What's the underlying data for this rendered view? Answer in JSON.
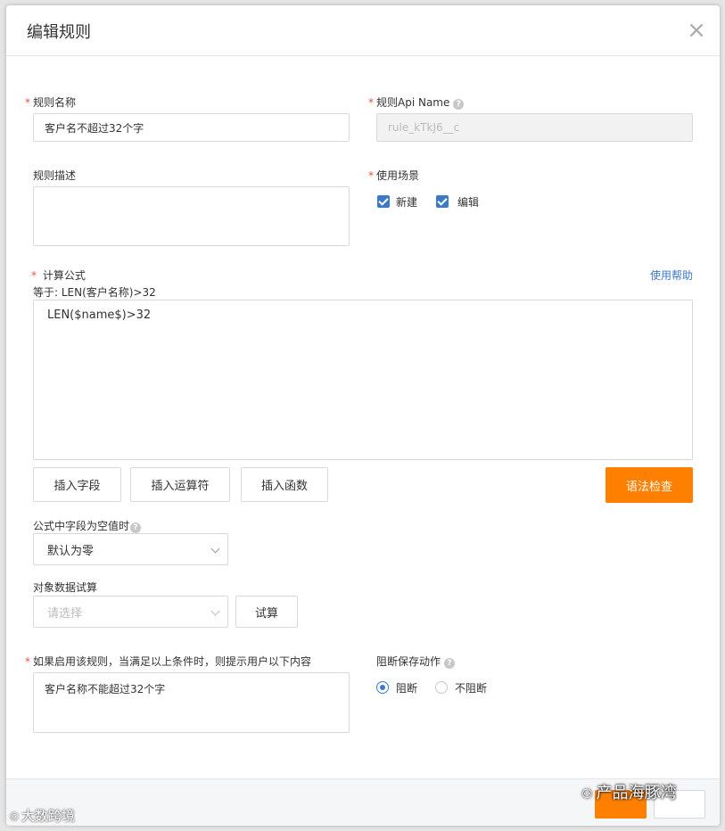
{
  "dialog": {
    "title": "编辑规则",
    "close_glyph": "×"
  },
  "required_mark": "*",
  "rule_name": {
    "label": "规则名称",
    "value": "客户名不超过32个字"
  },
  "rule_api_name": {
    "label": "规则Api Name",
    "help_glyph": "?",
    "value": "rule_kTkJ6__c"
  },
  "rule_description": {
    "label": "规则描述",
    "value": ""
  },
  "usage_scene": {
    "label": "使用场景",
    "options": [
      {
        "label": "新建",
        "checked": true
      },
      {
        "label": "编辑",
        "checked": true
      }
    ]
  },
  "formula": {
    "label": "计算公式",
    "help_link": "使用帮助",
    "equals_text": "等于: LEN(客户名称)>32",
    "value": "LEN($name$)>32",
    "insert_field": "插入字段",
    "insert_operator": "插入运算符",
    "insert_function": "插入函数",
    "syntax_check": "语法检查"
  },
  "empty_field": {
    "label": "公式中字段为空值时",
    "help_glyph": "?",
    "selected": "默认为零"
  },
  "trial": {
    "label": "对象数据试算",
    "placeholder": "请选择",
    "button": "试算"
  },
  "prompt": {
    "label": "如果启用该规则，当满足以上条件时，则提示用户以下内容",
    "value": "客户名称不能超过32个字"
  },
  "block_save": {
    "label": "阻断保存动作",
    "help_glyph": "?",
    "options": [
      {
        "label": "阻断",
        "selected": true
      },
      {
        "label": "不阻断",
        "selected": false
      }
    ]
  },
  "watermarks": {
    "right": "产品海豚湾",
    "left": "大数跨境"
  },
  "colors": {
    "accent": "#ff7f00",
    "link": "#3c79c8",
    "required": "#f04e3e"
  }
}
